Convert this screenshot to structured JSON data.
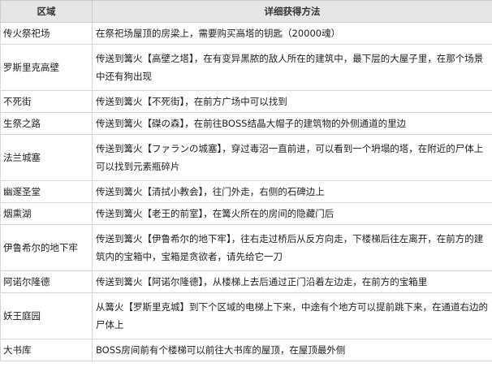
{
  "header": {
    "area": "区域",
    "method": "详细获得方法"
  },
  "rows": [
    {
      "area": "传火祭祀场",
      "method": "在祭祀场屋顶的房梁上，需要购买高塔的钥匙（20000魂）"
    },
    {
      "area": "罗斯里克高壁",
      "method": "传送到篝火【高壁之塔】，在有变异黑脓的敌人所在的建筑中，最下层的大屋子里，在那个场景中还有狗出现"
    },
    {
      "area": "不死街",
      "method": "传送到篝火【不死街】，在前方广场中可以找到"
    },
    {
      "area": "生祭之路",
      "method": "传送到篝火【磔の森】，在前往BOSS结晶大帽子的建筑物的外侧通道的里边"
    },
    {
      "area": "法兰城塞",
      "method": "传送到篝火【ファランの城塞】，穿过毒沼一直前进，可以看到一个坍塌的塔，在附近的尸体上可以找到元素瓶碎片"
    },
    {
      "area": "幽邃圣堂",
      "method": "传送到篝火【清拭小教会】，往门外走，右侧的石碑边上"
    },
    {
      "area": "烟熏湖",
      "method": "传送到篝火【老王的前室】，在篝火所在的房间的隐藏门后"
    },
    {
      "area": "伊鲁希尔的地下牢",
      "method": "传送到篝火【伊鲁希尔的地下牢】，往右走过桥后从反方向走，下楼梯后往左离开，在前方的建筑内的宝箱中，宝箱是贪欲者，请先给它一刀"
    },
    {
      "area": "阿诺尔隆德",
      "method": "传送到篝火【阿诺尔隆德】，从楼梯上去后通过正门沿着左边走，在前方的宝箱里"
    },
    {
      "area": "妖王庭园",
      "method": "从篝火【罗斯里克城】到下个区域的电梯上下来，中途有个地方可以提前跳下来，在通道右边的尸体上"
    },
    {
      "area": "大书库",
      "method": "BOSS房间前有个楼梯可以前往大书库的屋顶，在屋顶最外侧"
    }
  ]
}
